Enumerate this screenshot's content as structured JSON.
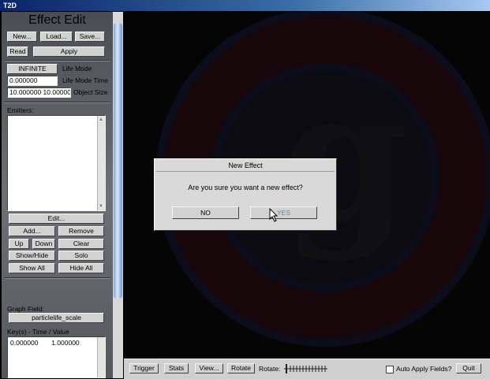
{
  "window": {
    "title": "T2D"
  },
  "panel": {
    "title": "Effect Edit",
    "buttons": {
      "new": "New...",
      "load": "Load...",
      "save": "Save...",
      "read": "Read",
      "apply": "Apply"
    },
    "life_mode": {
      "button": "INFINITE",
      "label": "Life Mode"
    },
    "life_mode_time": {
      "value": "0.000000",
      "label": "Life Mode Time"
    },
    "object_size": {
      "value": "10.000000 10.000000",
      "label": "Object Size"
    },
    "emitters": {
      "label": "Emitters:",
      "edit": "Edit...",
      "add": "Add...",
      "remove": "Remove",
      "up": "Up",
      "down": "Down",
      "clear": "Clear",
      "show_hide": "Show/Hide",
      "solo": "Solo",
      "show_all": "Show All",
      "hide_all": "Hide All"
    },
    "graph_field": {
      "label": "Graph Field:",
      "value": "particlelife_scale"
    },
    "keys": {
      "label": "Key(s) - Time / Value",
      "rows": [
        {
          "time": "0.000000",
          "value": "1.000000"
        }
      ]
    }
  },
  "dialog": {
    "title": "New Effect",
    "message": "Are you sure you want a new effect?",
    "no": "NO",
    "yes": "YES"
  },
  "bottom_bar": {
    "trigger": "Trigger",
    "stats": "Stats",
    "view": "View...",
    "rotate": "Rotate",
    "rotate_label": "Rotate:",
    "auto_apply": "Auto Apply Fields?",
    "auto_apply_checked": false,
    "quit": "Quit"
  },
  "icons": {
    "cursor": "arrow-pointer-icon",
    "logo": "g-logo-watermark"
  }
}
